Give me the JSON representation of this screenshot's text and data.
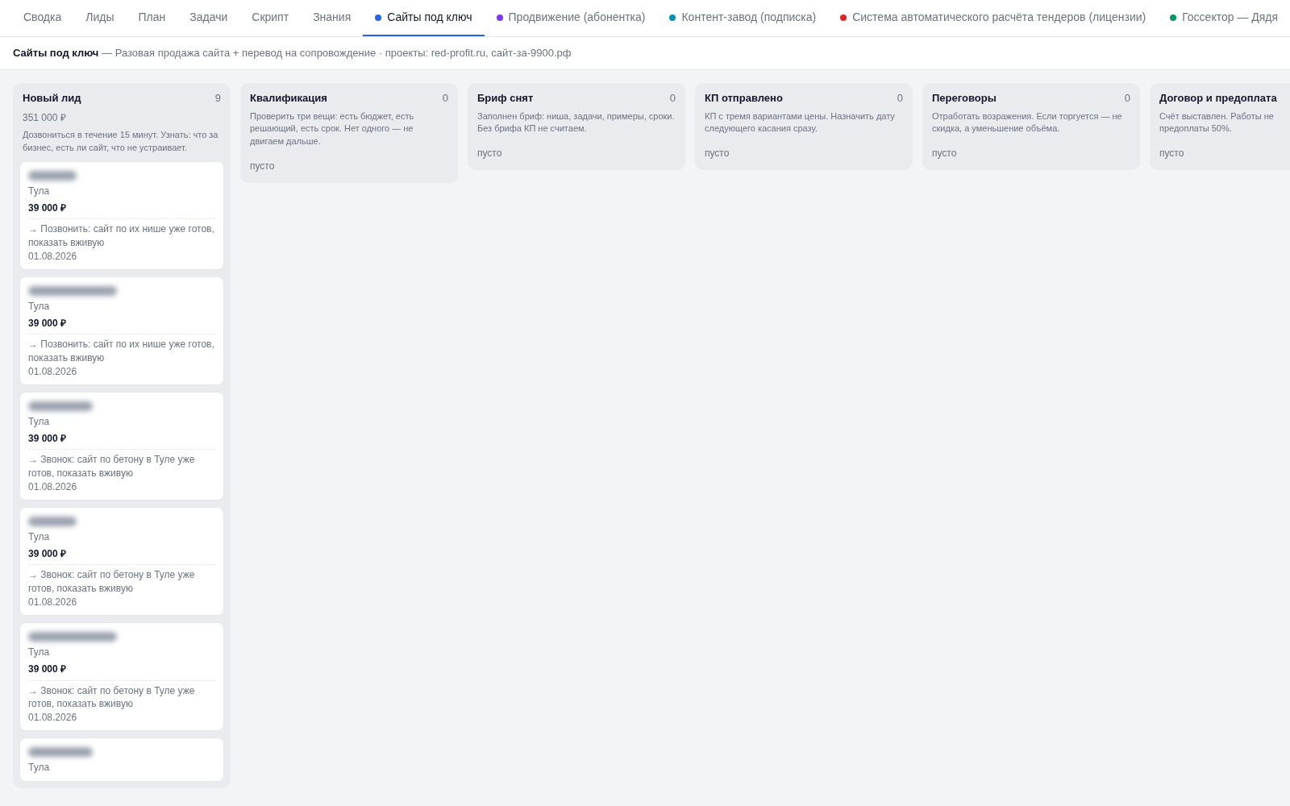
{
  "tabs": [
    {
      "label": "Сводка",
      "selected": false
    },
    {
      "label": "Лиды",
      "selected": false
    },
    {
      "label": "План",
      "selected": false
    },
    {
      "label": "Задачи",
      "selected": false
    },
    {
      "label": "Скрипт",
      "selected": false
    },
    {
      "label": "Знания",
      "selected": false
    },
    {
      "label": "Сайты под ключ",
      "selected": true,
      "color": "#2563eb"
    },
    {
      "label": "Продвижение (абонентка)",
      "selected": false,
      "color": "#7c3aed"
    },
    {
      "label": "Контент-завод (подписка)",
      "selected": false,
      "color": "#0891b2"
    },
    {
      "label": "Система автоматического расчёта тендеров (лицензии)",
      "selected": false,
      "color": "#dc2626"
    },
    {
      "label": "Госсектор — Дядя",
      "selected": false,
      "color": "#059669"
    }
  ],
  "subtitle": {
    "title": "Сайты под ключ",
    "text": "— Разовая продажа сайта + перевод на сопровождение · проекты: red-profit.ru, сайт-за-9900.рф"
  },
  "columns": [
    {
      "title": "Новый лид",
      "count": "9",
      "total": "351 000 ₽",
      "description": "Дозвониться в течение 15 минут. Узнать: что за бизнес, есть ли сайт, что не устраивает.",
      "cards": [
        {
          "title_redacted": true,
          "city": "Тула",
          "price": "39 000 ₽",
          "next_step": "→ Позвонить: сайт по их нише уже готов, показать вживую",
          "date": "01.08.2026"
        },
        {
          "title_redacted": true,
          "city": "Тула",
          "price": "39 000 ₽",
          "next_step": "→ Позвонить: сайт по их нише уже готов, показать вживую",
          "date": "01.08.2026"
        },
        {
          "title_redacted": true,
          "city": "Тула",
          "price": "39 000 ₽",
          "next_step": "→ Звонок: сайт по бетону в Туле уже готов, показать вживую",
          "date": "01.08.2026"
        },
        {
          "title_redacted": true,
          "city": "Тула",
          "price": "39 000 ₽",
          "next_step": "→ Звонок: сайт по бетону в Туле уже готов, показать вживую",
          "date": "01.08.2026"
        },
        {
          "title_redacted": true,
          "city": "Тула",
          "price": "39 000 ₽",
          "next_step": "→ Звонок: сайт по бетону в Туле уже готов, показать вживую",
          "date": "01.08.2026"
        },
        {
          "title_redacted": true,
          "city": "Тула"
        }
      ]
    },
    {
      "title": "Квалификация",
      "count": "0",
      "description": "Проверить три вещи: есть бюджет, есть решающий, есть срок. Нет одного — не двигаем дальше.",
      "empty": "пусто"
    },
    {
      "title": "Бриф снят",
      "count": "0",
      "description": "Заполнен бриф: ниша, задачи, примеры, сроки. Без брифа КП не считаем.",
      "empty": "пусто"
    },
    {
      "title": "КП отправлено",
      "count": "0",
      "description": "КП с тремя вариантами цены. Назначить дату следующего касания сразу.",
      "empty": "пусто"
    },
    {
      "title": "Переговоры",
      "count": "0",
      "description": "Отработать возражения. Если торгуется — не скидка, а уменьшение объёма.",
      "empty": "пусто"
    },
    {
      "title": "Договор и предоплата",
      "description": "Счёт выставлен. Работы не предоплаты 50%.",
      "empty": "пусто"
    }
  ]
}
